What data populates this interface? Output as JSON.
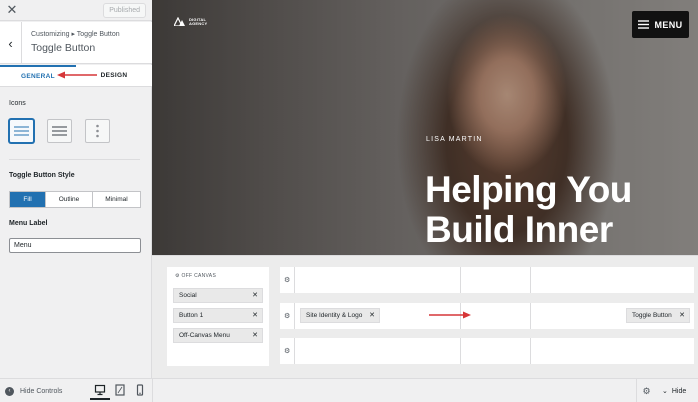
{
  "topbar": {
    "close_icon": "close-icon",
    "published_label": "Published"
  },
  "section": {
    "back_icon": "chevron-left-icon",
    "breadcrumb": "Customizing ▸ Toggle Button",
    "title": "Toggle Button"
  },
  "tabs": [
    {
      "label": "GENERAL",
      "active": true
    },
    {
      "label": "DESIGN",
      "active": false
    }
  ],
  "controls": {
    "icons_label": "Icons",
    "icon_options": [
      "menu-lines-icon",
      "menu-thick-lines-icon",
      "menu-vertical-dots-icon"
    ],
    "selected_icon": 0,
    "style_label": "Toggle Button Style",
    "style_options": [
      "Fill",
      "Outline",
      "Minimal"
    ],
    "style_selected": "Fill",
    "menu_label_label": "Menu Label",
    "menu_label_value": "Menu"
  },
  "hero": {
    "logo_text": "DIGITAL AGENCY",
    "menu_button_label": "MENU",
    "kicker": "LISA MARTIN",
    "heading": "Helping You Build Inner"
  },
  "builder": {
    "offcanvas_title": "OFF CANVAS",
    "offcanvas_items": [
      "Social",
      "Button 1",
      "Off-Canvas Menu"
    ],
    "main_row_left_item": "Site Identity & Logo",
    "main_row_right_item": "Toggle Button"
  },
  "bottombar": {
    "hide_controls_label": "Hide Controls",
    "hide_label": "Hide"
  },
  "colors": {
    "accent": "#2271b1",
    "arrow": "#d63638",
    "menu_button_bg": "#111111"
  }
}
